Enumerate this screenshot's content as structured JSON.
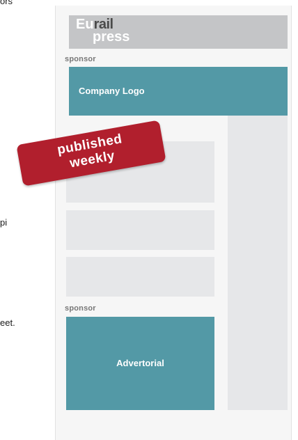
{
  "left_text": {
    "top": "ors",
    "middle": "pi",
    "bottom": "eet."
  },
  "newsletter": {
    "brand": {
      "eu": "Eu",
      "rail": "rail",
      "press": "press"
    },
    "sponsor_top_label": "sponsor",
    "company_logo_label": "Company Logo",
    "sponsor_bottom_label": "sponsor",
    "advertorial_label": "Advertorial",
    "badge": {
      "line1": "published",
      "line2": "weekly"
    }
  },
  "colors": {
    "teal": "#5399a6",
    "badge_red": "#b11f2d",
    "header_gray": "#c4c5c7",
    "block_gray": "#e6e7e9"
  }
}
